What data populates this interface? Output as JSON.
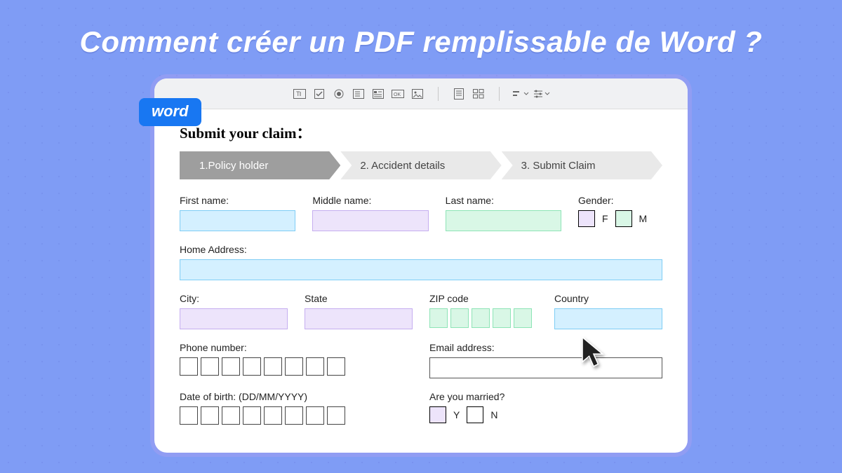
{
  "headline": "Comment créer un PDF remplissable de Word ?",
  "tag": "word",
  "doc_title": "Submit your claim：",
  "steps": [
    {
      "label": "1.Policy holder",
      "active": true
    },
    {
      "label": "2. Accident details",
      "active": false
    },
    {
      "label": "3. Submit Claim",
      "active": false
    }
  ],
  "labels": {
    "first_name": "First name:",
    "middle_name": "Middle name:",
    "last_name": "Last name:",
    "gender": "Gender:",
    "gender_f": "F",
    "gender_m": "M",
    "home_address": "Home Address:",
    "city": "City:",
    "state": "State",
    "zip": "ZIP code",
    "country": "Country",
    "phone": "Phone number:",
    "email": "Email address:",
    "dob": "Date of birth: (DD/MM/YYYY)",
    "married": "Are you married?",
    "married_y": "Y",
    "married_n": "N"
  },
  "colors": {
    "bg": "#7f9cf5",
    "blue_fill": "#d4f0ff",
    "purple_fill": "#ede4fb",
    "green_fill": "#d9f7e6"
  }
}
